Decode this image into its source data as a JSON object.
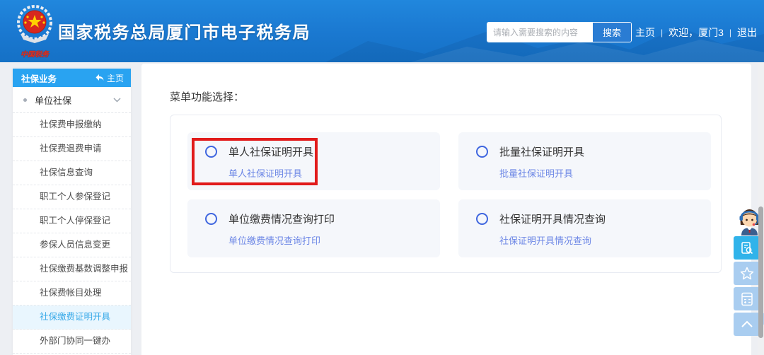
{
  "header": {
    "title": "国家税务总局厦门市电子税务局",
    "logo_caption": "中国税务",
    "search": {
      "placeholder": "请输入需要搜索的内容",
      "button_label": "搜索"
    },
    "nav": {
      "home": "主页",
      "welcome": "欢迎，厦门3",
      "logout": "退出",
      "separator": "|"
    }
  },
  "sidebar": {
    "header": {
      "title": "社保业务",
      "home_link": "主页"
    },
    "parent_item": "单位社保",
    "items": [
      "社保费申报缴纳",
      "社保费退费申请",
      "社保信息查询",
      "职工个人参保登记",
      "职工个人停保登记",
      "参保人员信息变更",
      "社保缴费基数调整申报",
      "社保费帐目处理",
      "社保缴费证明开具",
      "外部门协同一键办"
    ],
    "active_item": "社保缴费证明开具"
  },
  "main": {
    "section_label": "菜单功能选择：",
    "cards": [
      {
        "title": "单人社保证明开具",
        "link": "单人社保证明开具",
        "highlighted": "true"
      },
      {
        "title": "批量社保证明开具",
        "link": "批量社保证明开具"
      },
      {
        "title": "单位缴费情况查询打印",
        "link": "单位缴费情况查询打印"
      },
      {
        "title": "社保证明开具情况查询",
        "link": "社保证明开具情况查询"
      }
    ]
  },
  "floating": {
    "icons": [
      "customer-service-avatar",
      "document-search",
      "favorite-star",
      "calculator",
      "back-to-top"
    ]
  },
  "colors": {
    "header_blue": "#1a78d0",
    "sidebar_header_blue": "#29a3f1",
    "active_item_blue": "#35a8e8",
    "link_blue": "#6d87e6",
    "radio_blue": "#3f66df",
    "annotation_red": "#e11b1b",
    "float_cyan": "#30b3ea",
    "float_light_blue": "#a9cdf0"
  }
}
